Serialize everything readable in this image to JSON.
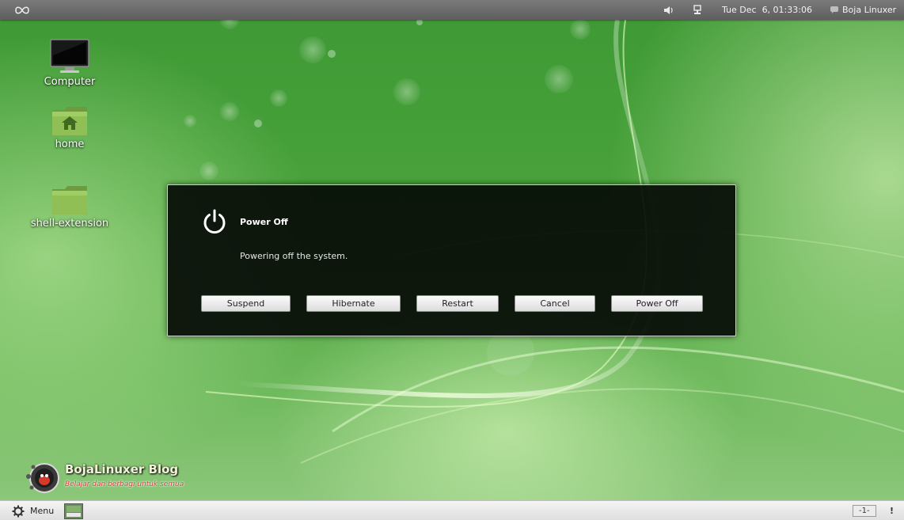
{
  "top_panel": {
    "clock": "Tue Dec  6, 01:33:06",
    "user_name": "Boja Linuxer"
  },
  "desktop": {
    "icons": [
      {
        "label": "Computer"
      },
      {
        "label": "home"
      },
      {
        "label": "shell-extension"
      }
    ]
  },
  "dialog": {
    "title": "Power Off",
    "message": "Powering off the system.",
    "buttons": {
      "suspend": "Suspend",
      "hibernate": "Hibernate",
      "restart": "Restart",
      "cancel": "Cancel",
      "power_off": "Power Off"
    }
  },
  "watermark": {
    "title": "BojaLinuxer Blog",
    "subtitle": "Belajar dan berbagi untuk semua"
  },
  "bottom_panel": {
    "menu_label": "Menu",
    "workspace_label": "-1-",
    "notification_label": "!"
  },
  "colors": {
    "accent_green": "#4aa33c",
    "dialog_bg": "#060a06",
    "panel_top": "#6a6a6a"
  }
}
